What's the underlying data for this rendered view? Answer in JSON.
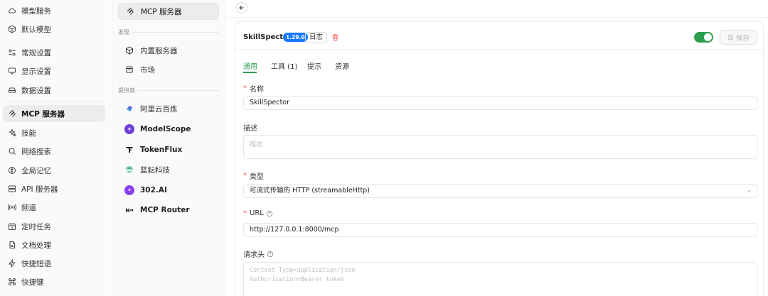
{
  "sidebar": {
    "items": [
      {
        "label": "模型服务",
        "icon": "cloud-icon"
      },
      {
        "label": "默认模型",
        "icon": "cube-icon"
      },
      {
        "label": "常规设置",
        "icon": "settings-sliders-icon"
      },
      {
        "label": "显示设置",
        "icon": "monitor-icon"
      },
      {
        "label": "数据设置",
        "icon": "hard-drive-icon"
      },
      {
        "label": "MCP 服务器",
        "icon": "mcp-icon"
      },
      {
        "label": "技能",
        "icon": "sparkles-icon"
      },
      {
        "label": "网络搜索",
        "icon": "search-icon"
      },
      {
        "label": "全局记忆",
        "icon": "brain-icon"
      },
      {
        "label": "API 服务器",
        "icon": "server-icon"
      },
      {
        "label": "频道",
        "icon": "broadcast-icon"
      },
      {
        "label": "定时任务",
        "icon": "calendar-clock-icon"
      },
      {
        "label": "文档处理",
        "icon": "document-icon"
      },
      {
        "label": "快捷短语",
        "icon": "zap-icon"
      },
      {
        "label": "快捷键",
        "icon": "command-icon"
      }
    ],
    "active": "MCP 服务器"
  },
  "provider_panel": {
    "top_item": "MCP 服务器",
    "discover_label": "发现",
    "discover_items": [
      "内置服务器",
      "市场"
    ],
    "providers_label": "提供商",
    "providers": [
      {
        "label": "阿里云百炼",
        "icon": "alibaba-bailian-logo-icon",
        "color": "#5b5bd6"
      },
      {
        "label": "ModelScope",
        "icon": "modelscope-logo-icon",
        "color": "#6d3fd6"
      },
      {
        "label": "TokenFlux",
        "icon": "tokenflux-logo-icon",
        "color": "#111111"
      },
      {
        "label": "蓝耘科技",
        "icon": "lanyun-logo-icon",
        "color": "#1aa37a"
      },
      {
        "label": "302.AI",
        "icon": "302ai-logo-icon",
        "color": "#8b3ff0"
      },
      {
        "label": "MCP Router",
        "icon": "mcp-router-logo-icon",
        "color": "#111111"
      }
    ]
  },
  "server": {
    "name": "SkillSpector",
    "version": "1.29.0",
    "log_label": "日志",
    "enabled": true,
    "save_label": "保存"
  },
  "tabs": [
    {
      "label": "通用",
      "active": true
    },
    {
      "label": "工具 (1)",
      "active": false
    },
    {
      "label": "提示",
      "active": false
    },
    {
      "label": "资源",
      "active": false
    }
  ],
  "form": {
    "name_label": "名称",
    "name_value": "SkillSpector",
    "desc_label": "描述",
    "desc_placeholder": "描述",
    "type_label": "类型",
    "type_value": "可流式传输的 HTTP (streamableHttp)",
    "url_label": "URL",
    "url_value": "http://127.0.0.1:8000/mcp",
    "headers_label": "请求头",
    "headers_placeholder_line1": "Content-Type=application/json",
    "headers_placeholder_line2": "Authorization=Bearer token"
  },
  "colors": {
    "accent": "#2e9e4f",
    "badge": "#1677ff",
    "required": "#ff4d4f"
  }
}
